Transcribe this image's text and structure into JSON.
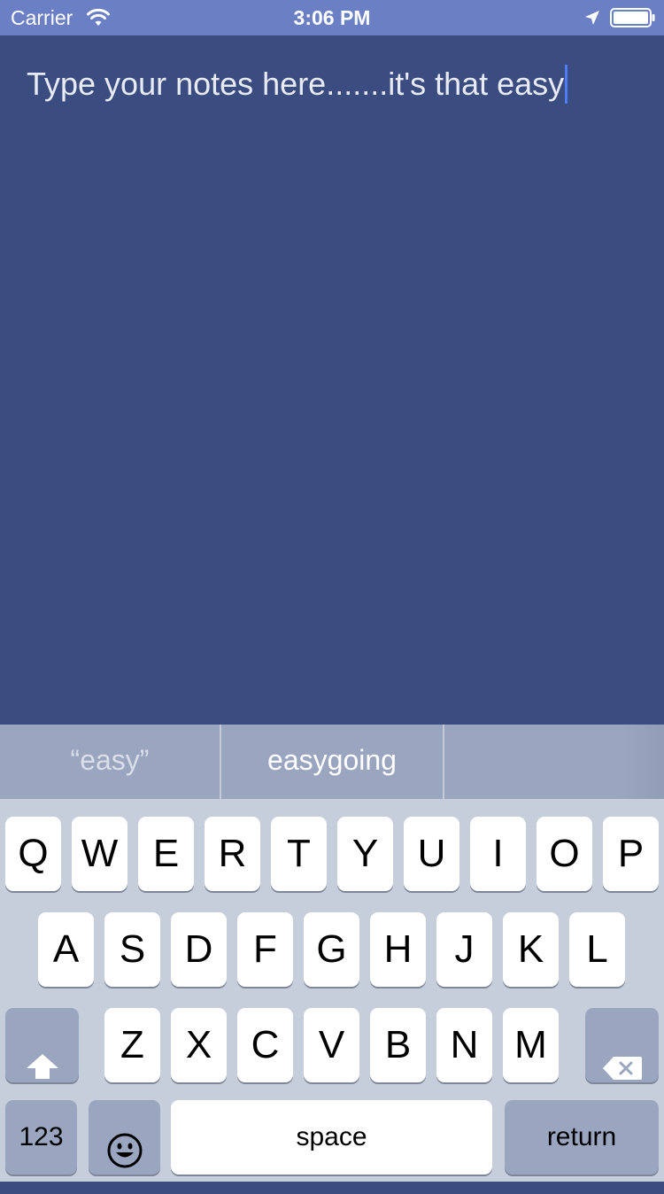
{
  "status_bar": {
    "carrier": "Carrier",
    "time": "3:06 PM",
    "icons": [
      "wifi-icon",
      "location-arrow-icon",
      "battery-icon"
    ]
  },
  "note": {
    "text": "Type your notes here.......it's that easy"
  },
  "predictive": {
    "suggestions": [
      "“easy”",
      "easygoing",
      ""
    ]
  },
  "keyboard": {
    "row1": [
      "Q",
      "W",
      "E",
      "R",
      "T",
      "Y",
      "U",
      "I",
      "O",
      "P"
    ],
    "row2": [
      "A",
      "S",
      "D",
      "F",
      "G",
      "H",
      "J",
      "K",
      "L"
    ],
    "row3": [
      "Z",
      "X",
      "C",
      "V",
      "B",
      "N",
      "M"
    ],
    "shift_icon": "shift-arrow-icon",
    "delete_icon": "backspace-icon",
    "numbers_label": "123",
    "emoji_icon": "emoji-face-icon",
    "space_label": "space",
    "return_label": "return"
  },
  "colors": {
    "status_bar": "#6a7fc4",
    "note_background": "#3b4d80",
    "caret": "#4f7cff",
    "keyboard_background": "#c7cedb",
    "dark_key": "#9aa6bf"
  }
}
